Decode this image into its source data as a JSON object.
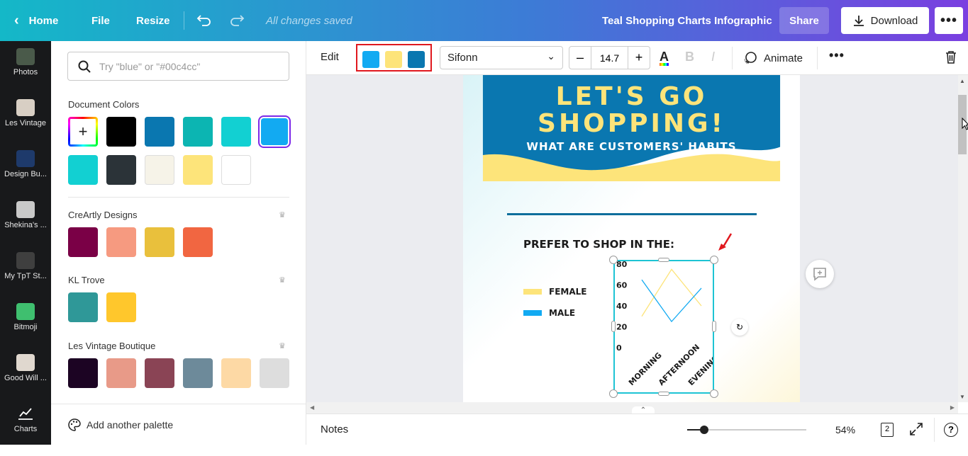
{
  "topbar": {
    "home": "Home",
    "file": "File",
    "resize": "Resize",
    "saved_status": "All changes saved",
    "doc_title": "Teal Shopping Charts Infographic",
    "share": "Share",
    "download": "Download"
  },
  "rail": [
    {
      "label": "Photos",
      "thumb": "#4a5a4a"
    },
    {
      "label": "Les Vintage",
      "thumb": "#d8cfc4"
    },
    {
      "label": "Design Bu...",
      "thumb": "#1e3a6b"
    },
    {
      "label": "Shekina's ...",
      "thumb": "#c9c9c9"
    },
    {
      "label": "My TpT St...",
      "thumb": "#3f3f3f"
    },
    {
      "label": "Bitmoji",
      "thumb": "#3fbf6f"
    },
    {
      "label": "Good Will ...",
      "thumb": "#e0d8cf"
    },
    {
      "label": "Charts",
      "thumb": "none"
    }
  ],
  "panel": {
    "search_placeholder": "Try \"blue\" or \"#00c4cc\"",
    "document_colors_title": "Document Colors",
    "document_colors": [
      "#000000",
      "#0a77b0",
      "#0cb5b2",
      "#12d0d2",
      "#12aaf2",
      "#12d0d2",
      "#2b3338",
      "#f6f3e8",
      "#fde47a",
      "#ffffff"
    ],
    "palettes": [
      {
        "name": "CreArtly Designs",
        "colors": [
          "#7a0046",
          "#f69a80",
          "#e9c03c",
          "#f16641"
        ]
      },
      {
        "name": "KL Trove",
        "colors": [
          "#2f9898",
          "#ffc72c"
        ]
      },
      {
        "name": "Les Vintage Boutique",
        "colors": [
          "#1c0423",
          "#e89a88",
          "#8a4455",
          "#6d8a9a",
          "#fdd9a5",
          "#dddddd"
        ]
      }
    ],
    "add_palette": "Add another palette"
  },
  "toolbar": {
    "edit": "Edit",
    "selected_colors": [
      "#12aaf2",
      "#fde47a",
      "#0a77b0"
    ],
    "font": "Sifonn",
    "font_size": "14.7",
    "animate": "Animate"
  },
  "page": {
    "title_line1": "LET'S GO",
    "title_line2": "SHOPPING!",
    "subtitle": "WHAT ARE CUSTOMERS' HABITS",
    "prefer": "PREFER TO SHOP IN THE:",
    "legend_female": "FEMALE",
    "legend_male": "MALE",
    "header_color": "#0a77b0",
    "wave_color": "#fde47a"
  },
  "chart_data": {
    "type": "line",
    "categories": [
      "MORNING",
      "AFTERNOON",
      "EVENING"
    ],
    "y_ticks": [
      "0",
      "20",
      "40",
      "60",
      "80"
    ],
    "ylim": [
      0,
      80
    ],
    "series": [
      {
        "name": "FEMALE",
        "color": "#fde47a",
        "values": [
          30,
          75,
          40
        ]
      },
      {
        "name": "MALE",
        "color": "#12aaf2",
        "values": [
          65,
          25,
          57
        ]
      }
    ]
  },
  "bottombar": {
    "notes": "Notes",
    "zoom": "54%",
    "zoom_fraction": 0.1,
    "page_count": "2"
  }
}
